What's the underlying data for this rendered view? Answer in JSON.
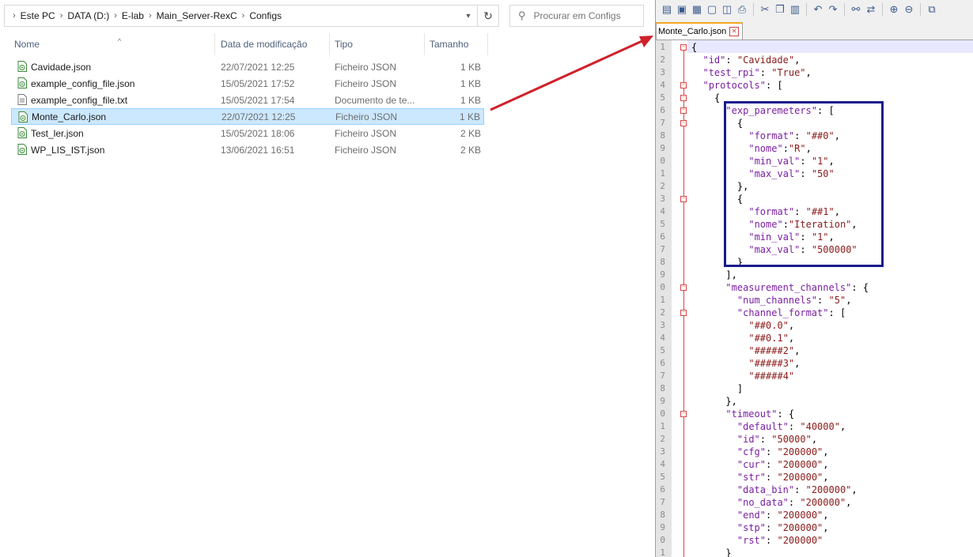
{
  "explorer": {
    "breadcrumb": [
      "Este PC",
      "DATA (D:)",
      "E-lab",
      "Main_Server-RexC",
      "Configs"
    ],
    "search_placeholder": "Procurar em Configs",
    "columns": {
      "name": "Nome",
      "date": "Data de modificação",
      "type": "Tipo",
      "size": "Tamanho"
    },
    "files": [
      {
        "name": "Cavidade.json",
        "date": "22/07/2021 12:25",
        "type": "Ficheiro JSON",
        "size": "1 KB",
        "icon": "json-file-icon"
      },
      {
        "name": "example_config_file.json",
        "date": "15/05/2021 17:52",
        "type": "Ficheiro JSON",
        "size": "1 KB",
        "icon": "json-file-icon"
      },
      {
        "name": "example_config_file.txt",
        "date": "15/05/2021 17:54",
        "type": "Documento de te...",
        "size": "1 KB",
        "icon": "text-file-icon"
      },
      {
        "name": "Monte_Carlo.json",
        "date": "22/07/2021 12:25",
        "type": "Ficheiro JSON",
        "size": "1 KB",
        "icon": "json-file-icon",
        "selected": true
      },
      {
        "name": "Test_ler.json",
        "date": "15/05/2021 18:06",
        "type": "Ficheiro JSON",
        "size": "2 KB",
        "icon": "json-file-icon"
      },
      {
        "name": "WP_LIS_IST.json",
        "date": "13/06/2021 16:51",
        "type": "Ficheiro JSON",
        "size": "2 KB",
        "icon": "json-file-icon"
      }
    ]
  },
  "editor": {
    "tab_label": "Monte_Carlo.json",
    "lines": [
      {
        "n": "1",
        "t": "{"
      },
      {
        "n": "2",
        "t": "  \"id\": \"Cavidade\","
      },
      {
        "n": "3",
        "t": "  \"test_rpi\": \"True\","
      },
      {
        "n": "4",
        "t": "  \"protocols\": ["
      },
      {
        "n": "5",
        "t": "    {"
      },
      {
        "n": "6",
        "t": "      \"exp_paremeters\": ["
      },
      {
        "n": "7",
        "t": "        {"
      },
      {
        "n": "8",
        "t": "          \"format\": \"##0\","
      },
      {
        "n": "9",
        "t": "          \"nome\":\"R\","
      },
      {
        "n": "0",
        "t": "          \"min_val\": \"1\","
      },
      {
        "n": "1",
        "t": "          \"max_val\": \"50\""
      },
      {
        "n": "2",
        "t": "        },"
      },
      {
        "n": "3",
        "t": "        {"
      },
      {
        "n": "4",
        "t": "          \"format\": \"##1\","
      },
      {
        "n": "5",
        "t": "          \"nome\":\"Iteration\","
      },
      {
        "n": "6",
        "t": "          \"min_val\": \"1\","
      },
      {
        "n": "7",
        "t": "          \"max_val\": \"500000\""
      },
      {
        "n": "8",
        "t": "        }"
      },
      {
        "n": "9",
        "t": "      ],"
      },
      {
        "n": "0",
        "t": "      \"measurement_channels\": {"
      },
      {
        "n": "1",
        "t": "        \"num_channels\": \"5\","
      },
      {
        "n": "2",
        "t": "        \"channel_format\": ["
      },
      {
        "n": "3",
        "t": "          \"##0.0\","
      },
      {
        "n": "4",
        "t": "          \"##0.1\","
      },
      {
        "n": "5",
        "t": "          \"#####2\","
      },
      {
        "n": "6",
        "t": "          \"#####3\","
      },
      {
        "n": "7",
        "t": "          \"#####4\""
      },
      {
        "n": "8",
        "t": "        ]"
      },
      {
        "n": "9",
        "t": "      },"
      },
      {
        "n": "0",
        "t": "      \"timeout\": {"
      },
      {
        "n": "1",
        "t": "        \"default\": \"40000\","
      },
      {
        "n": "2",
        "t": "        \"id\": \"50000\","
      },
      {
        "n": "3",
        "t": "        \"cfg\": \"200000\","
      },
      {
        "n": "4",
        "t": "        \"cur\": \"200000\","
      },
      {
        "n": "5",
        "t": "        \"str\": \"200000\","
      },
      {
        "n": "6",
        "t": "        \"data_bin\": \"200000\","
      },
      {
        "n": "7",
        "t": "        \"no_data\": \"200000\","
      },
      {
        "n": "8",
        "t": "        \"end\": \"200000\","
      },
      {
        "n": "9",
        "t": "        \"stp\": \"200000\","
      },
      {
        "n": "0",
        "t": "        \"rst\": \"200000\""
      },
      {
        "n": "1",
        "t": "      }"
      }
    ],
    "fold_lines": [
      1,
      4,
      5,
      6,
      7,
      13,
      20,
      22,
      30
    ]
  },
  "colors": {
    "selection_bg": "#cce8ff",
    "json_key": "#7a1fa2",
    "json_value": "#8b1a1a",
    "highlight_box": "#1a1a8c",
    "arrow": "#d0202a"
  }
}
